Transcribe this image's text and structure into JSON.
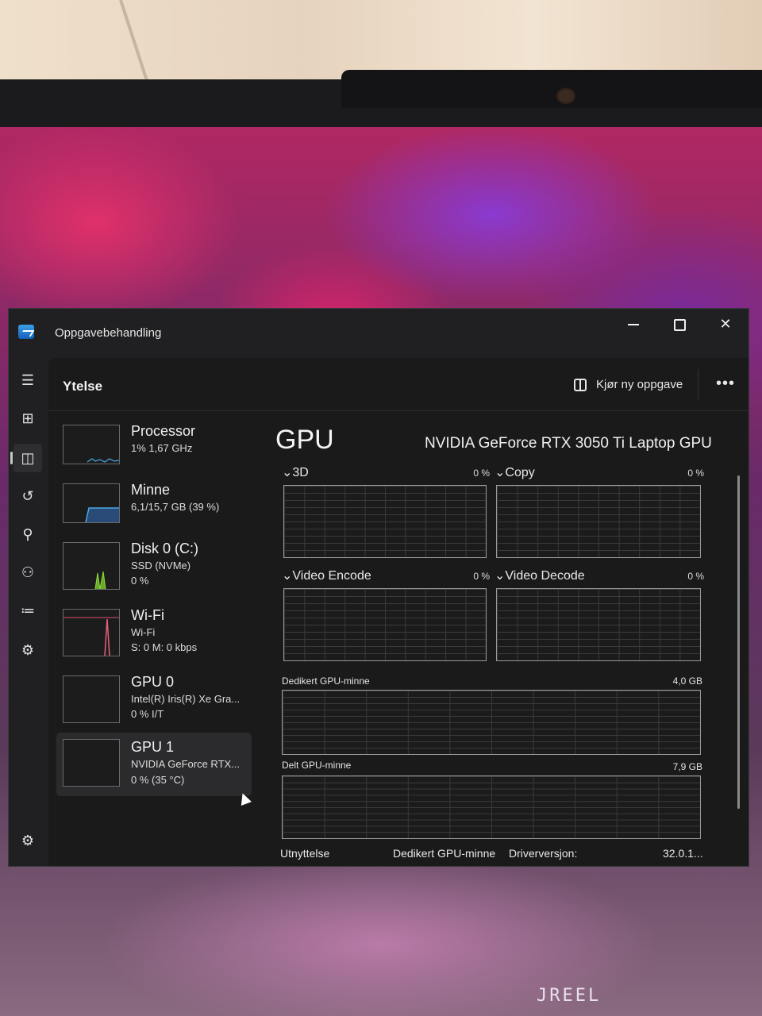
{
  "window": {
    "title": "Oppgavebehandling",
    "controls": {
      "minimize": "–",
      "maximize": "□",
      "close": "✕"
    }
  },
  "nav": {
    "items": [
      {
        "icon": "hamburger-menu-icon",
        "glyph": "☰"
      },
      {
        "icon": "processes-icon",
        "glyph": "⊞"
      },
      {
        "icon": "performance-icon",
        "glyph": "◫",
        "active": true
      },
      {
        "icon": "app-history-icon",
        "glyph": "↺"
      },
      {
        "icon": "startup-apps-icon",
        "glyph": "⚲"
      },
      {
        "icon": "users-icon",
        "glyph": "⚇"
      },
      {
        "icon": "details-icon",
        "glyph": "≔"
      },
      {
        "icon": "services-icon",
        "glyph": "⚙"
      }
    ],
    "settings": {
      "icon": "settings-gear-icon",
      "glyph": "⚙"
    }
  },
  "header": {
    "title": "Ytelse",
    "run_task": "Kjør ny oppgave",
    "more": "•••"
  },
  "devices": [
    {
      "name": "Processor",
      "line1": "1%  1,67 GHz",
      "line2": ""
    },
    {
      "name": "Minne",
      "line1": "6,1/15,7 GB (39 %)",
      "line2": ""
    },
    {
      "name": "Disk 0 (C:)",
      "line1": "SSD (NVMe)",
      "line2": "0 %"
    },
    {
      "name": "Wi-Fi",
      "line1": "Wi-Fi",
      "line2": "S: 0  M: 0 kbps"
    },
    {
      "name": "GPU 0",
      "line1": "Intel(R) Iris(R) Xe Gra...",
      "line2": "0 %  I/T"
    },
    {
      "name": "GPU 1",
      "line1": "NVIDIA GeForce RTX...",
      "line2": "0 %  (35 °C)",
      "selected": true
    }
  ],
  "detail": {
    "title": "GPU",
    "model": "NVIDIA GeForce RTX 3050 Ti Laptop GPU",
    "engines": [
      {
        "label": "3D",
        "percent": "0 %"
      },
      {
        "label": "Copy",
        "percent": "0 %"
      },
      {
        "label": "Video Encode",
        "percent": "0 %"
      },
      {
        "label": "Video Decode",
        "percent": "0 %"
      }
    ],
    "dedicated_memory": {
      "label": "Dedikert GPU-minne",
      "max": "4,0 GB"
    },
    "shared_memory": {
      "label": "Delt GPU-minne",
      "max": "7,9 GB"
    },
    "footer": {
      "utilization": "Utnyttelse",
      "dedicated": "Dedikert GPU-minne",
      "driver_label": "Driverversjon:",
      "driver_value": "32.0.1..."
    }
  },
  "photo": {
    "watermark": "JREEL"
  }
}
